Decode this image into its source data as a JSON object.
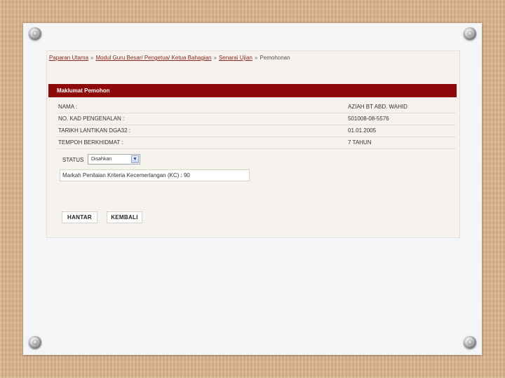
{
  "breadcrumb": {
    "items": [
      "Paparan Utama",
      "Modul Guru Besar/ Pengetua/ Ketua Bahagian",
      "Senarai Ujian",
      "Pemohonan"
    ]
  },
  "panel": {
    "title": "Maklumat Pemohon"
  },
  "info_rows": [
    {
      "label": "NAMA :",
      "value": "AZIAH BT ABD. WAHID"
    },
    {
      "label": "NO. KAD PENGENALAN :",
      "value": "501008-08-5576"
    },
    {
      "label": "TARIKH LANTIKAN DGA32 :",
      "value": "01.01.2005"
    },
    {
      "label": "TEMPOH BERKHIDMAT :",
      "value": "7 TAHUN"
    }
  ],
  "status": {
    "label": "STATUS",
    "selected": "Disahkan"
  },
  "marks": {
    "label": "Markah Penilaian Kriteria Kecemerlangan (KC) :",
    "value": "90"
  },
  "buttons": {
    "submit": "HANTAR",
    "back": "KEMBALI"
  },
  "colors": {
    "panel_header": "#8e0a0a",
    "background": "#d8b48f"
  }
}
